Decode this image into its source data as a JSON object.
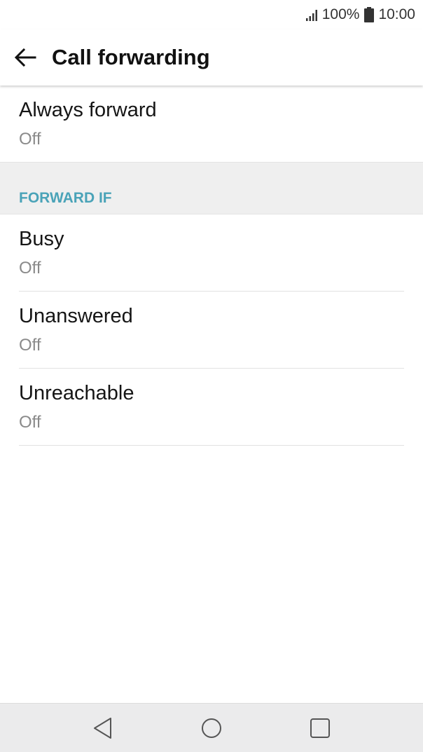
{
  "status_bar": {
    "battery_percent": "100%",
    "time": "10:00",
    "icons": [
      "signal-icon",
      "battery-icon"
    ]
  },
  "app_bar": {
    "title": "Call forwarding",
    "back_icon": "arrow-left-icon"
  },
  "always_forward": {
    "title": "Always forward",
    "summary": "Off"
  },
  "forward_if_section": {
    "label": "FORWARD IF",
    "color": "#4aa3b8",
    "items": [
      {
        "title": "Busy",
        "summary": "Off"
      },
      {
        "title": "Unanswered",
        "summary": "Off"
      },
      {
        "title": "Unreachable",
        "summary": "Off"
      }
    ]
  },
  "nav_bar": {
    "icons": [
      "nav-back-icon",
      "nav-home-icon",
      "nav-recents-icon"
    ]
  }
}
